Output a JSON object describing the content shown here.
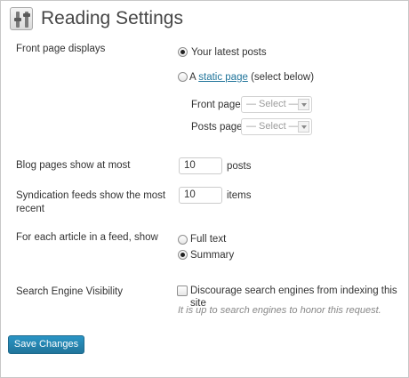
{
  "header": {
    "title": "Reading Settings",
    "icon": "settings-icon"
  },
  "front_page": {
    "label": "Front page displays",
    "option_latest": "Your latest posts",
    "option_static_prefix": "A",
    "option_static_link": "static page",
    "option_static_suffix": "(select below)",
    "selected": "latest",
    "front_page_label": "Front page:",
    "front_page_value": "— Select —",
    "posts_page_label": "Posts page:",
    "posts_page_value": "— Select —"
  },
  "blog_pages": {
    "label": "Blog pages show at most",
    "value": "10",
    "unit": "posts"
  },
  "syndication": {
    "label_line1": "Syndication feeds show the most",
    "label_line2": "recent",
    "value": "10",
    "unit": "items"
  },
  "feed_article": {
    "label": "For each article in a feed, show",
    "option_full": "Full text",
    "option_summary": "Summary",
    "selected": "summary"
  },
  "search_visibility": {
    "label": "Search Engine Visibility",
    "checkbox_label": "Discourage search engines from indexing this site",
    "checked": false,
    "hint": "It is up to search engines to honor this request."
  },
  "actions": {
    "save_label": "Save Changes"
  },
  "colors": {
    "link": "#21759b",
    "button": "#21759b"
  }
}
